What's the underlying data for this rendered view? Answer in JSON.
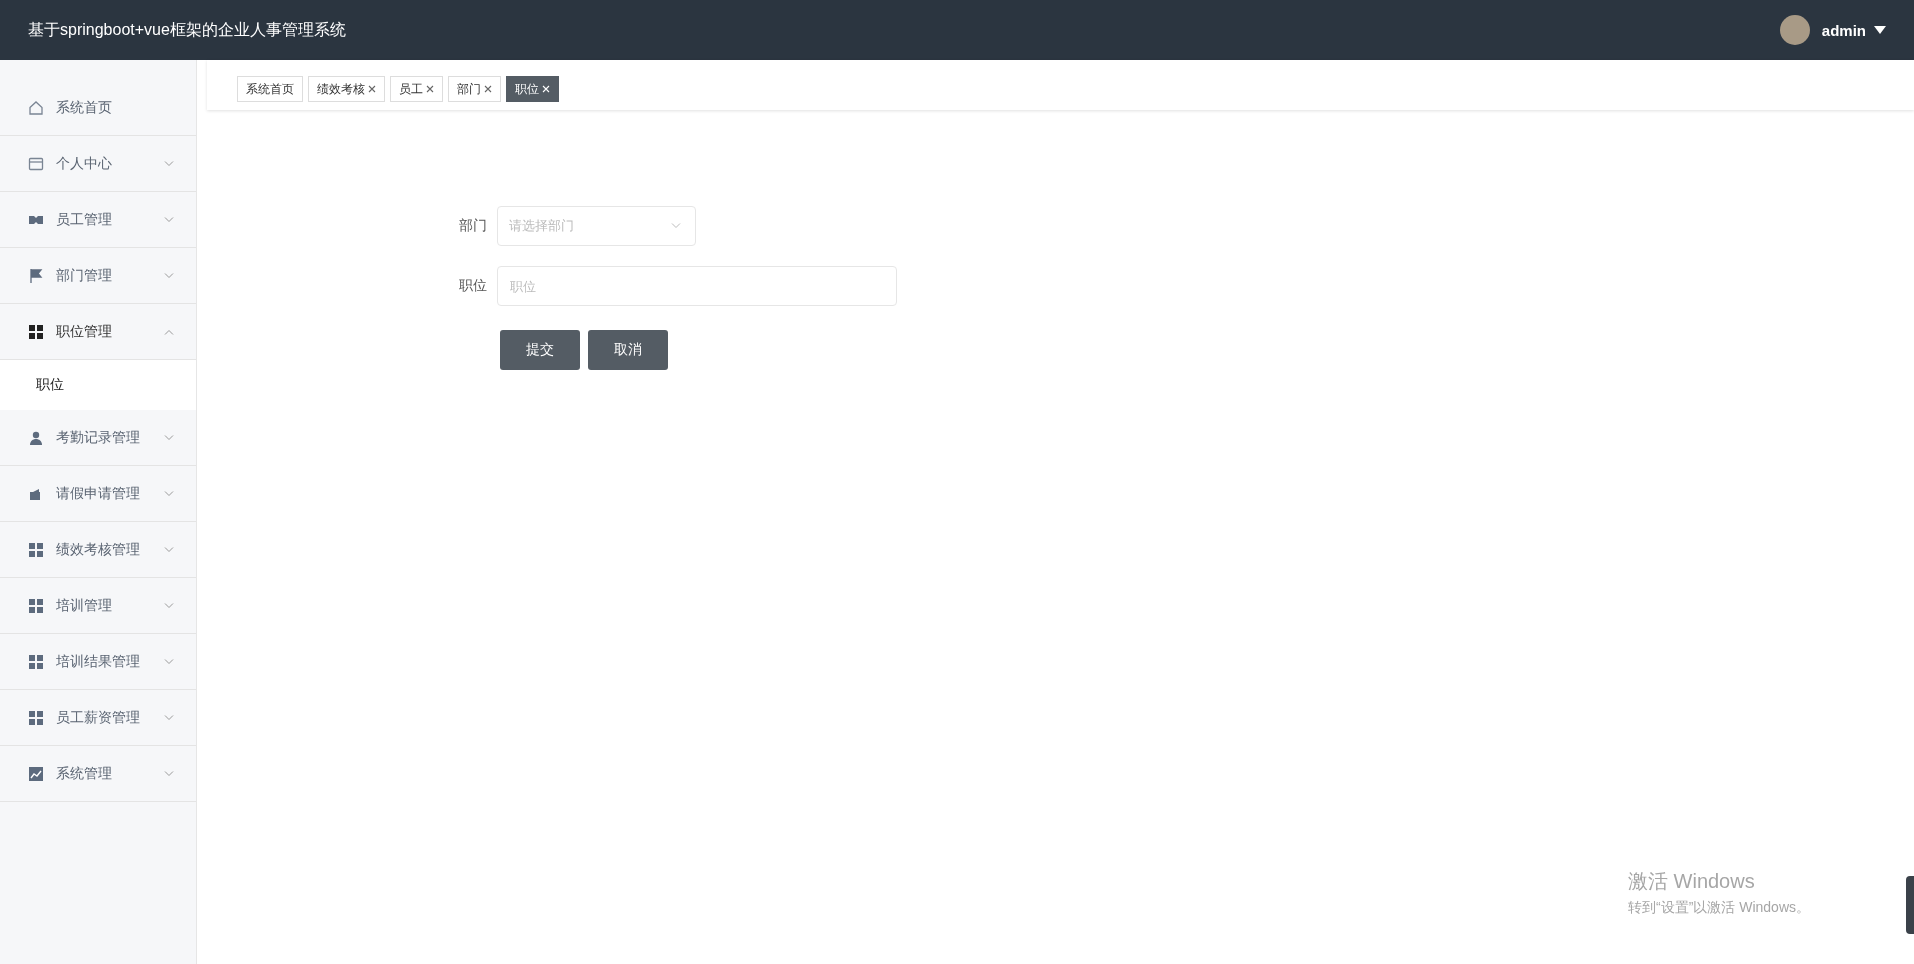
{
  "header": {
    "title": "基于springboot+vue框架的企业人事管理系统",
    "user": "admin"
  },
  "sidebar": {
    "items": [
      {
        "label": "系统首页",
        "kind": "link"
      },
      {
        "label": "个人中心",
        "kind": "submenu",
        "expanded": false
      },
      {
        "label": "员工管理",
        "kind": "submenu",
        "expanded": false
      },
      {
        "label": "部门管理",
        "kind": "submenu",
        "expanded": false
      },
      {
        "label": "职位管理",
        "kind": "submenu",
        "expanded": true,
        "children": [
          {
            "label": "职位",
            "selected": true
          }
        ]
      },
      {
        "label": "考勤记录管理",
        "kind": "submenu",
        "expanded": false
      },
      {
        "label": "请假申请管理",
        "kind": "submenu",
        "expanded": false
      },
      {
        "label": "绩效考核管理",
        "kind": "submenu",
        "expanded": false
      },
      {
        "label": "培训管理",
        "kind": "submenu",
        "expanded": false
      },
      {
        "label": "培训结果管理",
        "kind": "submenu",
        "expanded": false
      },
      {
        "label": "员工薪资管理",
        "kind": "submenu",
        "expanded": false
      },
      {
        "label": "系统管理",
        "kind": "submenu",
        "expanded": false
      }
    ]
  },
  "tabs": [
    {
      "label": "系统首页",
      "closable": false,
      "selected": false
    },
    {
      "label": "绩效考核",
      "closable": true,
      "selected": false
    },
    {
      "label": "员工",
      "closable": true,
      "selected": false
    },
    {
      "label": "部门",
      "closable": true,
      "selected": false
    },
    {
      "label": "职位",
      "closable": true,
      "selected": true
    }
  ],
  "form": {
    "fields": [
      {
        "label": "部门",
        "kind": "select",
        "placeholder": "请选择部门"
      },
      {
        "label": "职位",
        "kind": "input",
        "placeholder": "职位"
      }
    ],
    "buttons": [
      "提交",
      "取消"
    ]
  },
  "windows_activation": {
    "title": "激活 Windows",
    "hint": "转到“设置”以激活 Windows。"
  }
}
